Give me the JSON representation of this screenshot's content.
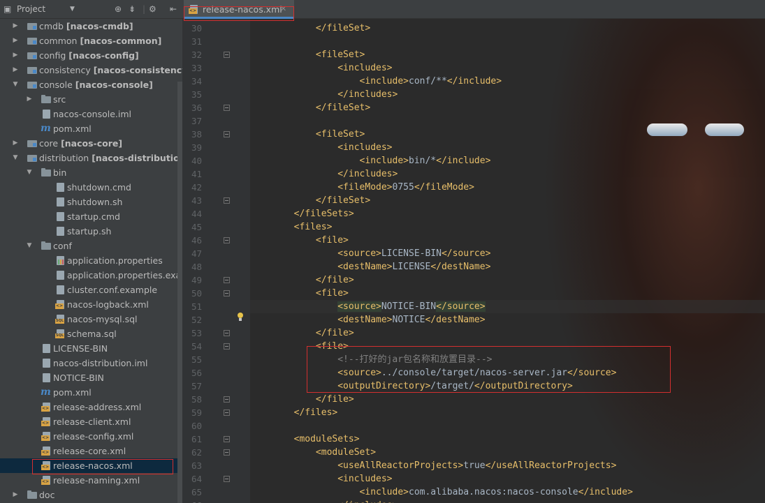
{
  "panel": {
    "title": "Project"
  },
  "tree": [
    {
      "label": "cmdb",
      "module": "[nacos-cmdb]",
      "type": "module",
      "level": 1,
      "arrow": "closed"
    },
    {
      "label": "common",
      "module": "[nacos-common]",
      "type": "module",
      "level": 1,
      "arrow": "closed"
    },
    {
      "label": "config",
      "module": "[nacos-config]",
      "type": "module",
      "level": 1,
      "arrow": "closed"
    },
    {
      "label": "consistency",
      "module": "[nacos-consistency]",
      "type": "module",
      "level": 1,
      "arrow": "closed"
    },
    {
      "label": "console",
      "module": "[nacos-console]",
      "type": "module",
      "level": 1,
      "arrow": "open"
    },
    {
      "label": "src",
      "type": "folder",
      "level": 2,
      "arrow": "closed"
    },
    {
      "label": "nacos-console.iml",
      "type": "file",
      "level": 2
    },
    {
      "label": "pom.xml",
      "type": "maven",
      "level": 2
    },
    {
      "label": "core",
      "module": "[nacos-core]",
      "type": "module",
      "level": 1,
      "arrow": "closed"
    },
    {
      "label": "distribution",
      "module": "[nacos-distribution]",
      "type": "module",
      "level": 1,
      "arrow": "open"
    },
    {
      "label": "bin",
      "type": "folder",
      "level": 2,
      "arrow": "open"
    },
    {
      "label": "shutdown.cmd",
      "type": "file",
      "level": 3
    },
    {
      "label": "shutdown.sh",
      "type": "file",
      "level": 3
    },
    {
      "label": "startup.cmd",
      "type": "file",
      "level": 3
    },
    {
      "label": "startup.sh",
      "type": "file",
      "level": 3
    },
    {
      "label": "conf",
      "type": "folder",
      "level": 2,
      "arrow": "open"
    },
    {
      "label": "application.properties",
      "type": "props",
      "level": 3
    },
    {
      "label": "application.properties.examp",
      "type": "file",
      "level": 3
    },
    {
      "label": "cluster.conf.example",
      "type": "file",
      "level": 3
    },
    {
      "label": "nacos-logback.xml",
      "type": "xml",
      "level": 3
    },
    {
      "label": "nacos-mysql.sql",
      "type": "sql",
      "level": 3
    },
    {
      "label": "schema.sql",
      "type": "sql",
      "level": 3
    },
    {
      "label": "LICENSE-BIN",
      "type": "file",
      "level": 2
    },
    {
      "label": "nacos-distribution.iml",
      "type": "file",
      "level": 2
    },
    {
      "label": "NOTICE-BIN",
      "type": "file",
      "level": 2
    },
    {
      "label": "pom.xml",
      "type": "maven",
      "level": 2
    },
    {
      "label": "release-address.xml",
      "type": "xml",
      "level": 2
    },
    {
      "label": "release-client.xml",
      "type": "xml",
      "level": 2
    },
    {
      "label": "release-config.xml",
      "type": "xml",
      "level": 2
    },
    {
      "label": "release-core.xml",
      "type": "xml",
      "level": 2
    },
    {
      "label": "release-nacos.xml",
      "type": "xml",
      "level": 2,
      "selected": true
    },
    {
      "label": "release-naming.xml",
      "type": "xml",
      "level": 2
    },
    {
      "label": "doc",
      "type": "folder",
      "level": 1,
      "arrow": "closed"
    }
  ],
  "editor": {
    "tab_label": "release-nacos.xml",
    "lines": [
      {
        "n": "30",
        "t": "            </fileSet>"
      },
      {
        "n": "31",
        "t": ""
      },
      {
        "n": "32",
        "t": "            <fileSet>"
      },
      {
        "n": "33",
        "t": "                <includes>"
      },
      {
        "n": "34",
        "t": "                    <include>conf/**</include>"
      },
      {
        "n": "35",
        "t": "                </includes>"
      },
      {
        "n": "36",
        "t": "            </fileSet>"
      },
      {
        "n": "37",
        "t": ""
      },
      {
        "n": "38",
        "t": "            <fileSet>"
      },
      {
        "n": "39",
        "t": "                <includes>"
      },
      {
        "n": "40",
        "t": "                    <include>bin/*</include>"
      },
      {
        "n": "41",
        "t": "                </includes>"
      },
      {
        "n": "42",
        "t": "                <fileMode>0755</fileMode>"
      },
      {
        "n": "43",
        "t": "            </fileSet>"
      },
      {
        "n": "44",
        "t": "        </fileSets>"
      },
      {
        "n": "45",
        "t": "        <files>"
      },
      {
        "n": "46",
        "t": "            <file>"
      },
      {
        "n": "47",
        "t": "                <source>LICENSE-BIN</source>"
      },
      {
        "n": "48",
        "t": "                <destName>LICENSE</destName>"
      },
      {
        "n": "49",
        "t": "            </file>"
      },
      {
        "n": "50",
        "t": "            <file>"
      },
      {
        "n": "51",
        "t": "                <source>NOTICE-BIN</source>"
      },
      {
        "n": "52",
        "t": "                <destName>NOTICE</destName>"
      },
      {
        "n": "53",
        "t": "            </file>"
      },
      {
        "n": "54",
        "t": "            <file>"
      },
      {
        "n": "55",
        "t": "                <!--打好的jar包名称和放置目录-->"
      },
      {
        "n": "56",
        "t": "                <source>../console/target/nacos-server.jar</source>"
      },
      {
        "n": "57",
        "t": "                <outputDirectory>/target/</outputDirectory>"
      },
      {
        "n": "58",
        "t": "            </file>"
      },
      {
        "n": "59",
        "t": "        </files>"
      },
      {
        "n": "60",
        "t": ""
      },
      {
        "n": "61",
        "t": "        <moduleSets>"
      },
      {
        "n": "62",
        "t": "            <moduleSet>"
      },
      {
        "n": "63",
        "t": "                <useAllReactorProjects>true</useAllReactorProjects>"
      },
      {
        "n": "64",
        "t": "                <includes>"
      },
      {
        "n": "65",
        "t": "                    <include>com.alibaba.nacos:nacos-console</include>"
      },
      {
        "n": "66",
        "t": "                </includes>"
      }
    ]
  },
  "colors": {
    "tag": "#e8bf6a",
    "text": "#a9b7c6",
    "comment": "#808080",
    "highlight_box": "#d32f2f"
  }
}
